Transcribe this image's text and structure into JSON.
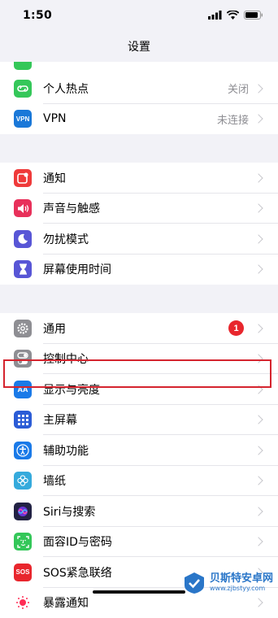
{
  "status_bar": {
    "time": "1:50"
  },
  "nav": {
    "title": "设置"
  },
  "group1": [
    {
      "label": "个人热点",
      "value": "关闭",
      "icon": "hotspot-icon",
      "color": "#34c759"
    },
    {
      "label": "VPN",
      "value": "未连接",
      "icon": "vpn-icon",
      "color": "#1a78d8",
      "icon_text": "VPN"
    }
  ],
  "group2": [
    {
      "label": "通知",
      "icon": "notification-icon",
      "color": "#ef3a3a"
    },
    {
      "label": "声音与触感",
      "icon": "sound-icon",
      "color": "#e8305a"
    },
    {
      "label": "勿扰模式",
      "icon": "moon-icon",
      "color": "#5856d6"
    },
    {
      "label": "屏幕使用时间",
      "icon": "hourglass-icon",
      "color": "#5856d6"
    }
  ],
  "group3": [
    {
      "label": "通用",
      "icon": "gear-icon",
      "color": "#8e8e93",
      "badge": "1"
    },
    {
      "label": "控制中心",
      "icon": "toggle-icon",
      "color": "#8e8e93"
    },
    {
      "label": "显示与亮度",
      "icon": "display-icon",
      "color": "#1a7ae8",
      "icon_text": "AA"
    },
    {
      "label": "主屏幕",
      "icon": "home-screen-icon",
      "color": "#2b5cd6"
    },
    {
      "label": "辅助功能",
      "icon": "accessibility-icon",
      "color": "#1a7ae8"
    },
    {
      "label": "墙纸",
      "icon": "wallpaper-icon",
      "color": "#35aadc"
    },
    {
      "label": "Siri与搜索",
      "icon": "siri-icon",
      "color": "#222244"
    },
    {
      "label": "面容ID与密码",
      "icon": "faceid-icon",
      "color": "#34c759"
    },
    {
      "label": "SOS紧急联络",
      "icon": "sos-icon",
      "color": "#e8262d",
      "icon_text": "SOS"
    },
    {
      "label": "暴露通知",
      "icon": "exposure-icon",
      "color": "#ffffff"
    }
  ],
  "watermark": {
    "title": "贝斯特安卓网",
    "url": "www.zjbstyy.com"
  }
}
